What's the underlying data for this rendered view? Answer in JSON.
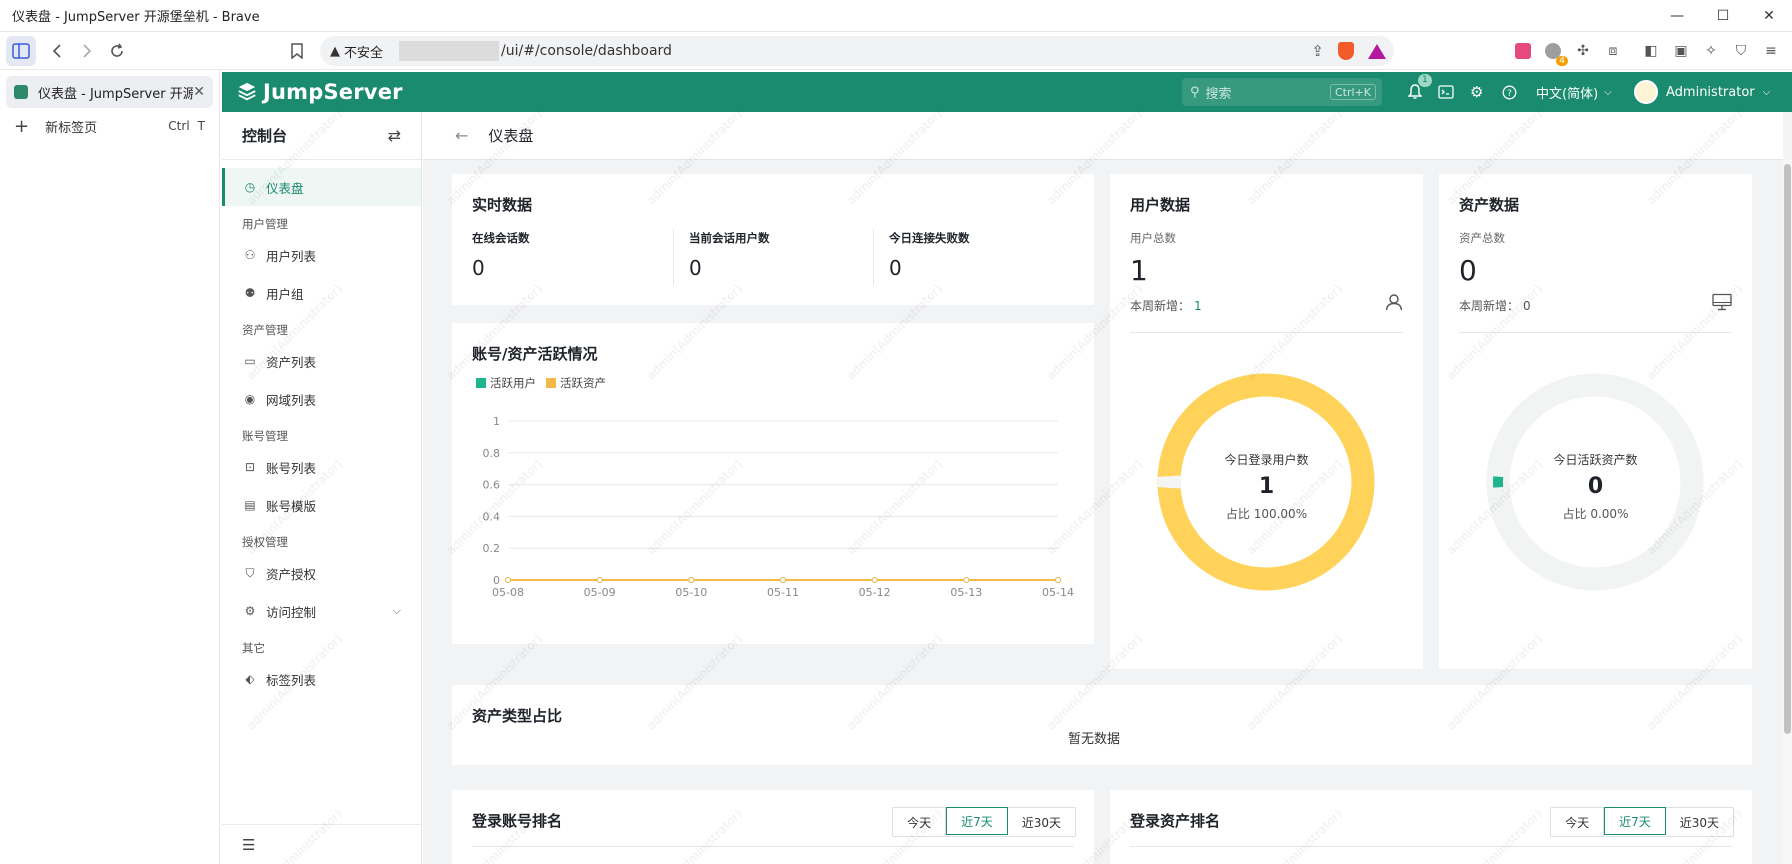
{
  "window": {
    "title": "仪表盘 - JumpServer 开源堡垒机 - Brave",
    "minimize": "—",
    "maximize": "☐",
    "close": "✕"
  },
  "toolbar": {
    "security_label": "不安全",
    "url": "/ui/#/console/dashboard"
  },
  "tabs": [
    {
      "title": "仪表盘 - JumpServer 开源",
      "active": true
    }
  ],
  "new_tab": {
    "label": "新标签页",
    "shortcut_ctrl": "Ctrl",
    "shortcut_key": "T"
  },
  "extensions": {
    "badge_count": "4"
  },
  "header": {
    "brand": "JumpServer",
    "search_placeholder": "搜索",
    "search_shortcut": "Ctrl+K",
    "notification_count": "1",
    "language": "中文(简体)",
    "username": "Administrator",
    "brand_color": "#1a8b6e"
  },
  "menu": {
    "title": "控制台",
    "items": [
      {
        "label": "仪表盘",
        "icon": "dashboard-icon",
        "active": true
      },
      {
        "group": "用户管理"
      },
      {
        "label": "用户列表",
        "icon": "user-icon"
      },
      {
        "label": "用户组",
        "icon": "users-icon"
      },
      {
        "group": "资产管理"
      },
      {
        "label": "资产列表",
        "icon": "monitor-icon"
      },
      {
        "label": "网域列表",
        "icon": "location-icon"
      },
      {
        "group": "账号管理"
      },
      {
        "label": "账号列表",
        "icon": "lock-icon"
      },
      {
        "label": "账号模版",
        "icon": "template-icon"
      },
      {
        "group": "授权管理"
      },
      {
        "label": "资产授权",
        "icon": "shield-check-icon"
      },
      {
        "label": "访问控制",
        "icon": "gear-users-icon",
        "expandable": true
      },
      {
        "group": "其它"
      },
      {
        "label": "标签列表",
        "icon": "tag-icon"
      }
    ]
  },
  "breadcrumb": {
    "title": "仪表盘"
  },
  "realtime": {
    "title": "实时数据",
    "stats": [
      {
        "label": "在线会话数",
        "value": "0"
      },
      {
        "label": "当前会话用户数",
        "value": "0"
      },
      {
        "label": "今日连接失败数",
        "value": "0"
      }
    ]
  },
  "user_data": {
    "title": "用户数据",
    "total_label": "用户总数",
    "total": "1",
    "week_label": "本周新增：",
    "week_value": "1",
    "donut_title": "今日登录用户数",
    "donut_value": "1",
    "donut_ratio": "占比 100.00%",
    "ratio_fraction": 0.97,
    "color": "#ffd25a"
  },
  "asset_data": {
    "title": "资产数据",
    "total_label": "资产总数",
    "total": "0",
    "week_label": "本周新增：",
    "week_value": "0",
    "donut_title": "今日活跃资产数",
    "donut_value": "0",
    "donut_ratio": "占比 0.00%",
    "ratio_fraction": 0.0,
    "color": "#f1f4f3",
    "marker_color": "#1fb48e"
  },
  "activity": {
    "title": "账号/资产活跃情况",
    "legend": [
      {
        "name": "活跃用户",
        "color": "#1fb48e"
      },
      {
        "name": "活跃资产",
        "color": "#f5b94a"
      }
    ]
  },
  "chart_data": {
    "type": "line",
    "x": [
      "05-08",
      "05-09",
      "05-10",
      "05-11",
      "05-12",
      "05-13",
      "05-14"
    ],
    "yticks": [
      "0",
      "0.2",
      "0.4",
      "0.6",
      "0.8",
      "1"
    ],
    "ylim": [
      0,
      1
    ],
    "series": [
      {
        "name": "活跃用户",
        "values": [
          0,
          0,
          0,
          0,
          0,
          0,
          0
        ],
        "color": "#1fb48e"
      },
      {
        "name": "活跃资产",
        "values": [
          0,
          0,
          0,
          0,
          0,
          0,
          0
        ],
        "color": "#f5b94a"
      }
    ],
    "grid": true
  },
  "asset_type": {
    "title": "资产类型占比",
    "empty": "暂无数据"
  },
  "login_account_rank": {
    "title": "登录账号排名",
    "ranges": [
      "今天",
      "近7天",
      "近30天"
    ],
    "active_range": 1
  },
  "login_asset_rank": {
    "title": "登录资产排名",
    "ranges": [
      "今天",
      "近7天",
      "近30天"
    ],
    "active_range": 1
  },
  "watermark": "admin(Administrator)"
}
